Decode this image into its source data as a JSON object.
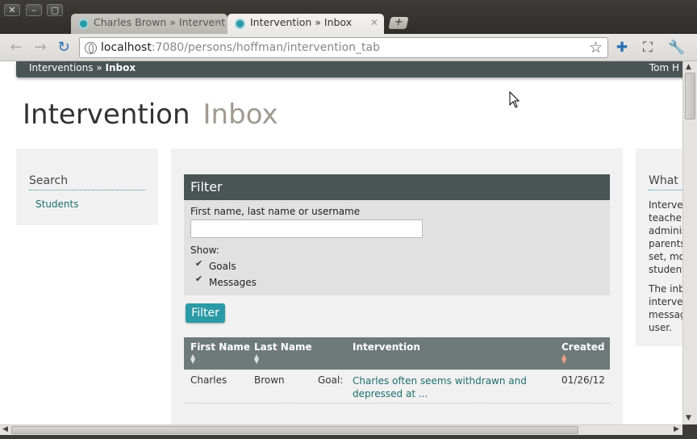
{
  "window": {
    "controls": [
      "✕",
      "–",
      "▢"
    ]
  },
  "tabs": [
    {
      "title": "Charles Brown » Intervent",
      "active": false
    },
    {
      "title": "Intervention » Inbox",
      "active": true
    }
  ],
  "toolbar": {
    "url_host": "localhost",
    "url_rest": ":7080/persons/hoffman/intervention_tab"
  },
  "page": {
    "breadcrumb_first": "Interventions",
    "breadcrumb_sep": " » ",
    "breadcrumb_current": "Inbox",
    "user_name": "Tom H",
    "title": "Intervention",
    "subtitle": "Inbox"
  },
  "sidebar_left": {
    "heading": "Search",
    "link": "Students"
  },
  "filter": {
    "heading": "Filter",
    "name_label": "First name, last name or username",
    "name_value": "",
    "show_label": "Show:",
    "goals_label": "Goals",
    "goals_checked": true,
    "messages_label": "Messages",
    "messages_checked": true,
    "button_label": "Filter"
  },
  "table": {
    "headers": [
      "First Name",
      "Last Name",
      "Intervention",
      "Created"
    ],
    "rows": [
      {
        "first_name": "Charles",
        "last_name": "Brown",
        "type": "Goal:",
        "intervention_line1": "Charles often seems withdrawn and",
        "intervention_line2": "depressed at ...",
        "created": "01/26/12"
      }
    ]
  },
  "sidebar_right": {
    "heading": "What i",
    "para1_lines": [
      "Interve",
      "teacher",
      "adminis",
      "parents",
      "set, mo",
      "student"
    ],
    "para2_lines": [
      "The inb",
      "interve",
      "messag",
      "user."
    ]
  },
  "colors": {
    "accent": "#2a9aa6",
    "header_dark": "#4a5454",
    "table_head": "#6e7a78",
    "link": "#1f6e6e"
  }
}
